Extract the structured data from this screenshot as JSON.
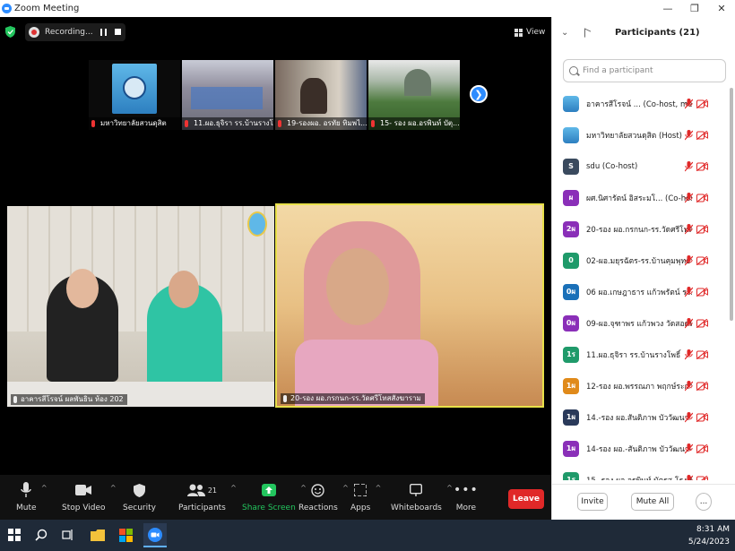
{
  "window": {
    "title": "Zoom Meeting",
    "minimize_icon": "minimize-icon",
    "restore_icon": "restore-icon",
    "close_icon": "close-icon"
  },
  "meeting": {
    "recording_label": "Recording...",
    "view_label": "View",
    "thumbnails": [
      {
        "name": "มหาวิทยาลัยสวนดุสิต"
      },
      {
        "name": "11.ผอ.ธุจิรา รร.บ้านรางโ..."
      },
      {
        "name": "19-รองผอ. อรทัย ทิมพไ..."
      },
      {
        "name": "15- รอง ผอ.อรพินท์ บัตุ..."
      }
    ],
    "main_videos": [
      {
        "name": "อาคารสีโรจน์ ผลพันธิน ห้อง 202"
      },
      {
        "name": "20-รอง ผอ.กรกนก-รร.วัดศรีโทสสังฆาราม"
      }
    ]
  },
  "toolbar": {
    "mute": "Mute",
    "stop_video": "Stop Video",
    "security": "Security",
    "participants": "Participants",
    "participants_count": "21",
    "share_screen": "Share Screen",
    "reactions": "Reactions",
    "apps": "Apps",
    "whiteboards": "Whiteboards",
    "more": "More",
    "leave": "Leave"
  },
  "panel": {
    "title": "Participants (21)",
    "search_placeholder": "Find a participant",
    "participants": [
      {
        "initials": "",
        "name": "อาคารสีโรจน์ ...  (Co-host, me)",
        "avatar_color": "#4aa0d8",
        "logo": true
      },
      {
        "initials": "",
        "name": "มหาวิทยาลัยสวนดุสิต (Host)",
        "avatar_color": "#4aa0d8",
        "logo": true
      },
      {
        "initials": "S",
        "name": "sdu (Co-host)",
        "avatar_color": "#3a4a5e"
      },
      {
        "initials": "ผ",
        "name": "ผศ.นิศารัตน์ อิสระมโ...  (Co-host)",
        "avatar_color": "#8a2fb8"
      },
      {
        "initials": "2ผ",
        "name": "20-รอง ผอ.กรกนก-รร.วัดศรีโทสสัง...",
        "avatar_color": "#8a2fb8"
      },
      {
        "initials": "0",
        "name": "02-ผอ.มยุรฉัตร-รร.บ้านคุมพุทธวงส์",
        "avatar_color": "#1f9a6a"
      },
      {
        "initials": "0ผ",
        "name": "06 ผอ.เกษฎาธาร แก้วพรัตน์ รร.ป...",
        "avatar_color": "#1a70b8"
      },
      {
        "initials": "0ผ",
        "name": "09-ผอ.จุฑาพร แก้วพวง วัดสอดห้อง",
        "avatar_color": "#8a2fb8"
      },
      {
        "initials": "1ร",
        "name": "11.ผอ.ธุจิรา รร.บ้านรางโพธิ์",
        "avatar_color": "#1f9a6a"
      },
      {
        "initials": "1ผ",
        "name": "12-รอง ผอ.พรรณภา พฤกษ์ระการ-...",
        "avatar_color": "#e08a1a"
      },
      {
        "initials": "1ผ",
        "name": "14.-รอง ผอ.สันติภาพ บัววัฒนา -รร....",
        "avatar_color": "#2a3a5a"
      },
      {
        "initials": "1ผ",
        "name": "14-รอง ผอ.-สันติภาพ บัววัฒนา-รร.โ...",
        "avatar_color": "#8a2fb8"
      },
      {
        "initials": "1ร",
        "name": "15- รอง ผอ.อรพินท์ บัตุรส-โรงเรียน",
        "avatar_color": "#1f9a6a"
      }
    ],
    "invite": "Invite",
    "mute_all": "Mute All",
    "more_label": "..."
  },
  "taskbar": {
    "time": "8:31 AM",
    "date": "5/24/2023"
  },
  "colors": {
    "accent": "#2d8cff",
    "leave": "#e02828",
    "share": "#23c55e",
    "muted_icon": "#e02828"
  }
}
